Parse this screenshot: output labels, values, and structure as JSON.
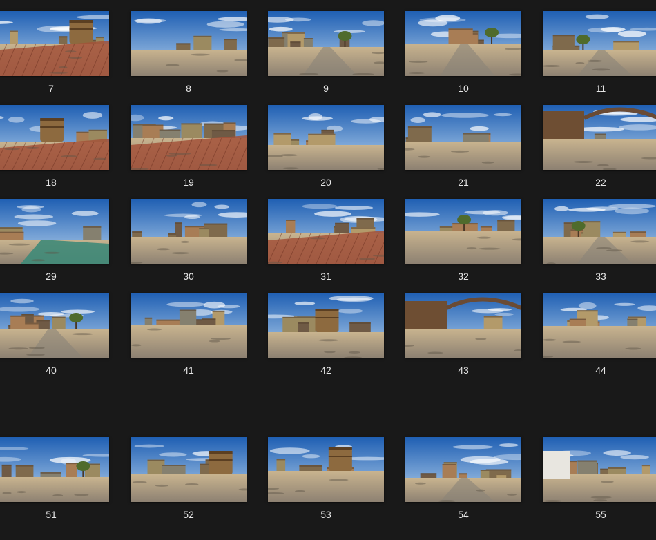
{
  "explorer": {
    "view": "large-icons",
    "palette": {
      "sky_top": "#1f5fb3",
      "sky_bottom": "#b8d4ee",
      "sand": "#c9b48f",
      "ground": "#8d8172",
      "roof_rust": "#a3523a",
      "building": "#9b8a60",
      "text": "#e6e6e6",
      "background": "#191919"
    },
    "rows": [
      {
        "items": [
          {
            "label": "7",
            "scene": "rust-roof-tower"
          },
          {
            "label": "8",
            "scene": "open-desert-wall"
          },
          {
            "label": "9",
            "scene": "road-tree-bunker"
          },
          {
            "label": "10",
            "scene": "street-trucks"
          },
          {
            "label": "11",
            "scene": "street-buildings"
          }
        ]
      },
      {
        "items": [
          {
            "label": "18",
            "scene": "rust-roof-tank"
          },
          {
            "label": "19",
            "scene": "rooftop-rust"
          },
          {
            "label": "20",
            "scene": "yard-debris"
          },
          {
            "label": "21",
            "scene": "yard-sun"
          },
          {
            "label": "22",
            "scene": "hangar-bridge"
          }
        ]
      },
      {
        "items": [
          {
            "label": "29",
            "scene": "green-roof"
          },
          {
            "label": "30",
            "scene": "rooftop-view"
          },
          {
            "label": "31",
            "scene": "corrugated-roof"
          },
          {
            "label": "32",
            "scene": "yard-tree"
          },
          {
            "label": "33",
            "scene": "street-corner"
          }
        ]
      },
      {
        "items": [
          {
            "label": "40",
            "scene": "road-tree-left"
          },
          {
            "label": "41",
            "scene": "sand-building"
          },
          {
            "label": "42",
            "scene": "tank-far"
          },
          {
            "label": "43",
            "scene": "pipe-arch"
          },
          {
            "label": "44",
            "scene": "fence-yard"
          }
        ]
      },
      {
        "items": [
          {
            "label": "51",
            "scene": "crates-tree"
          },
          {
            "label": "52",
            "scene": "tank-shadow"
          },
          {
            "label": "53",
            "scene": "tank-center"
          },
          {
            "label": "54",
            "scene": "cracked-road"
          },
          {
            "label": "55",
            "scene": "white-building"
          }
        ]
      }
    ]
  }
}
